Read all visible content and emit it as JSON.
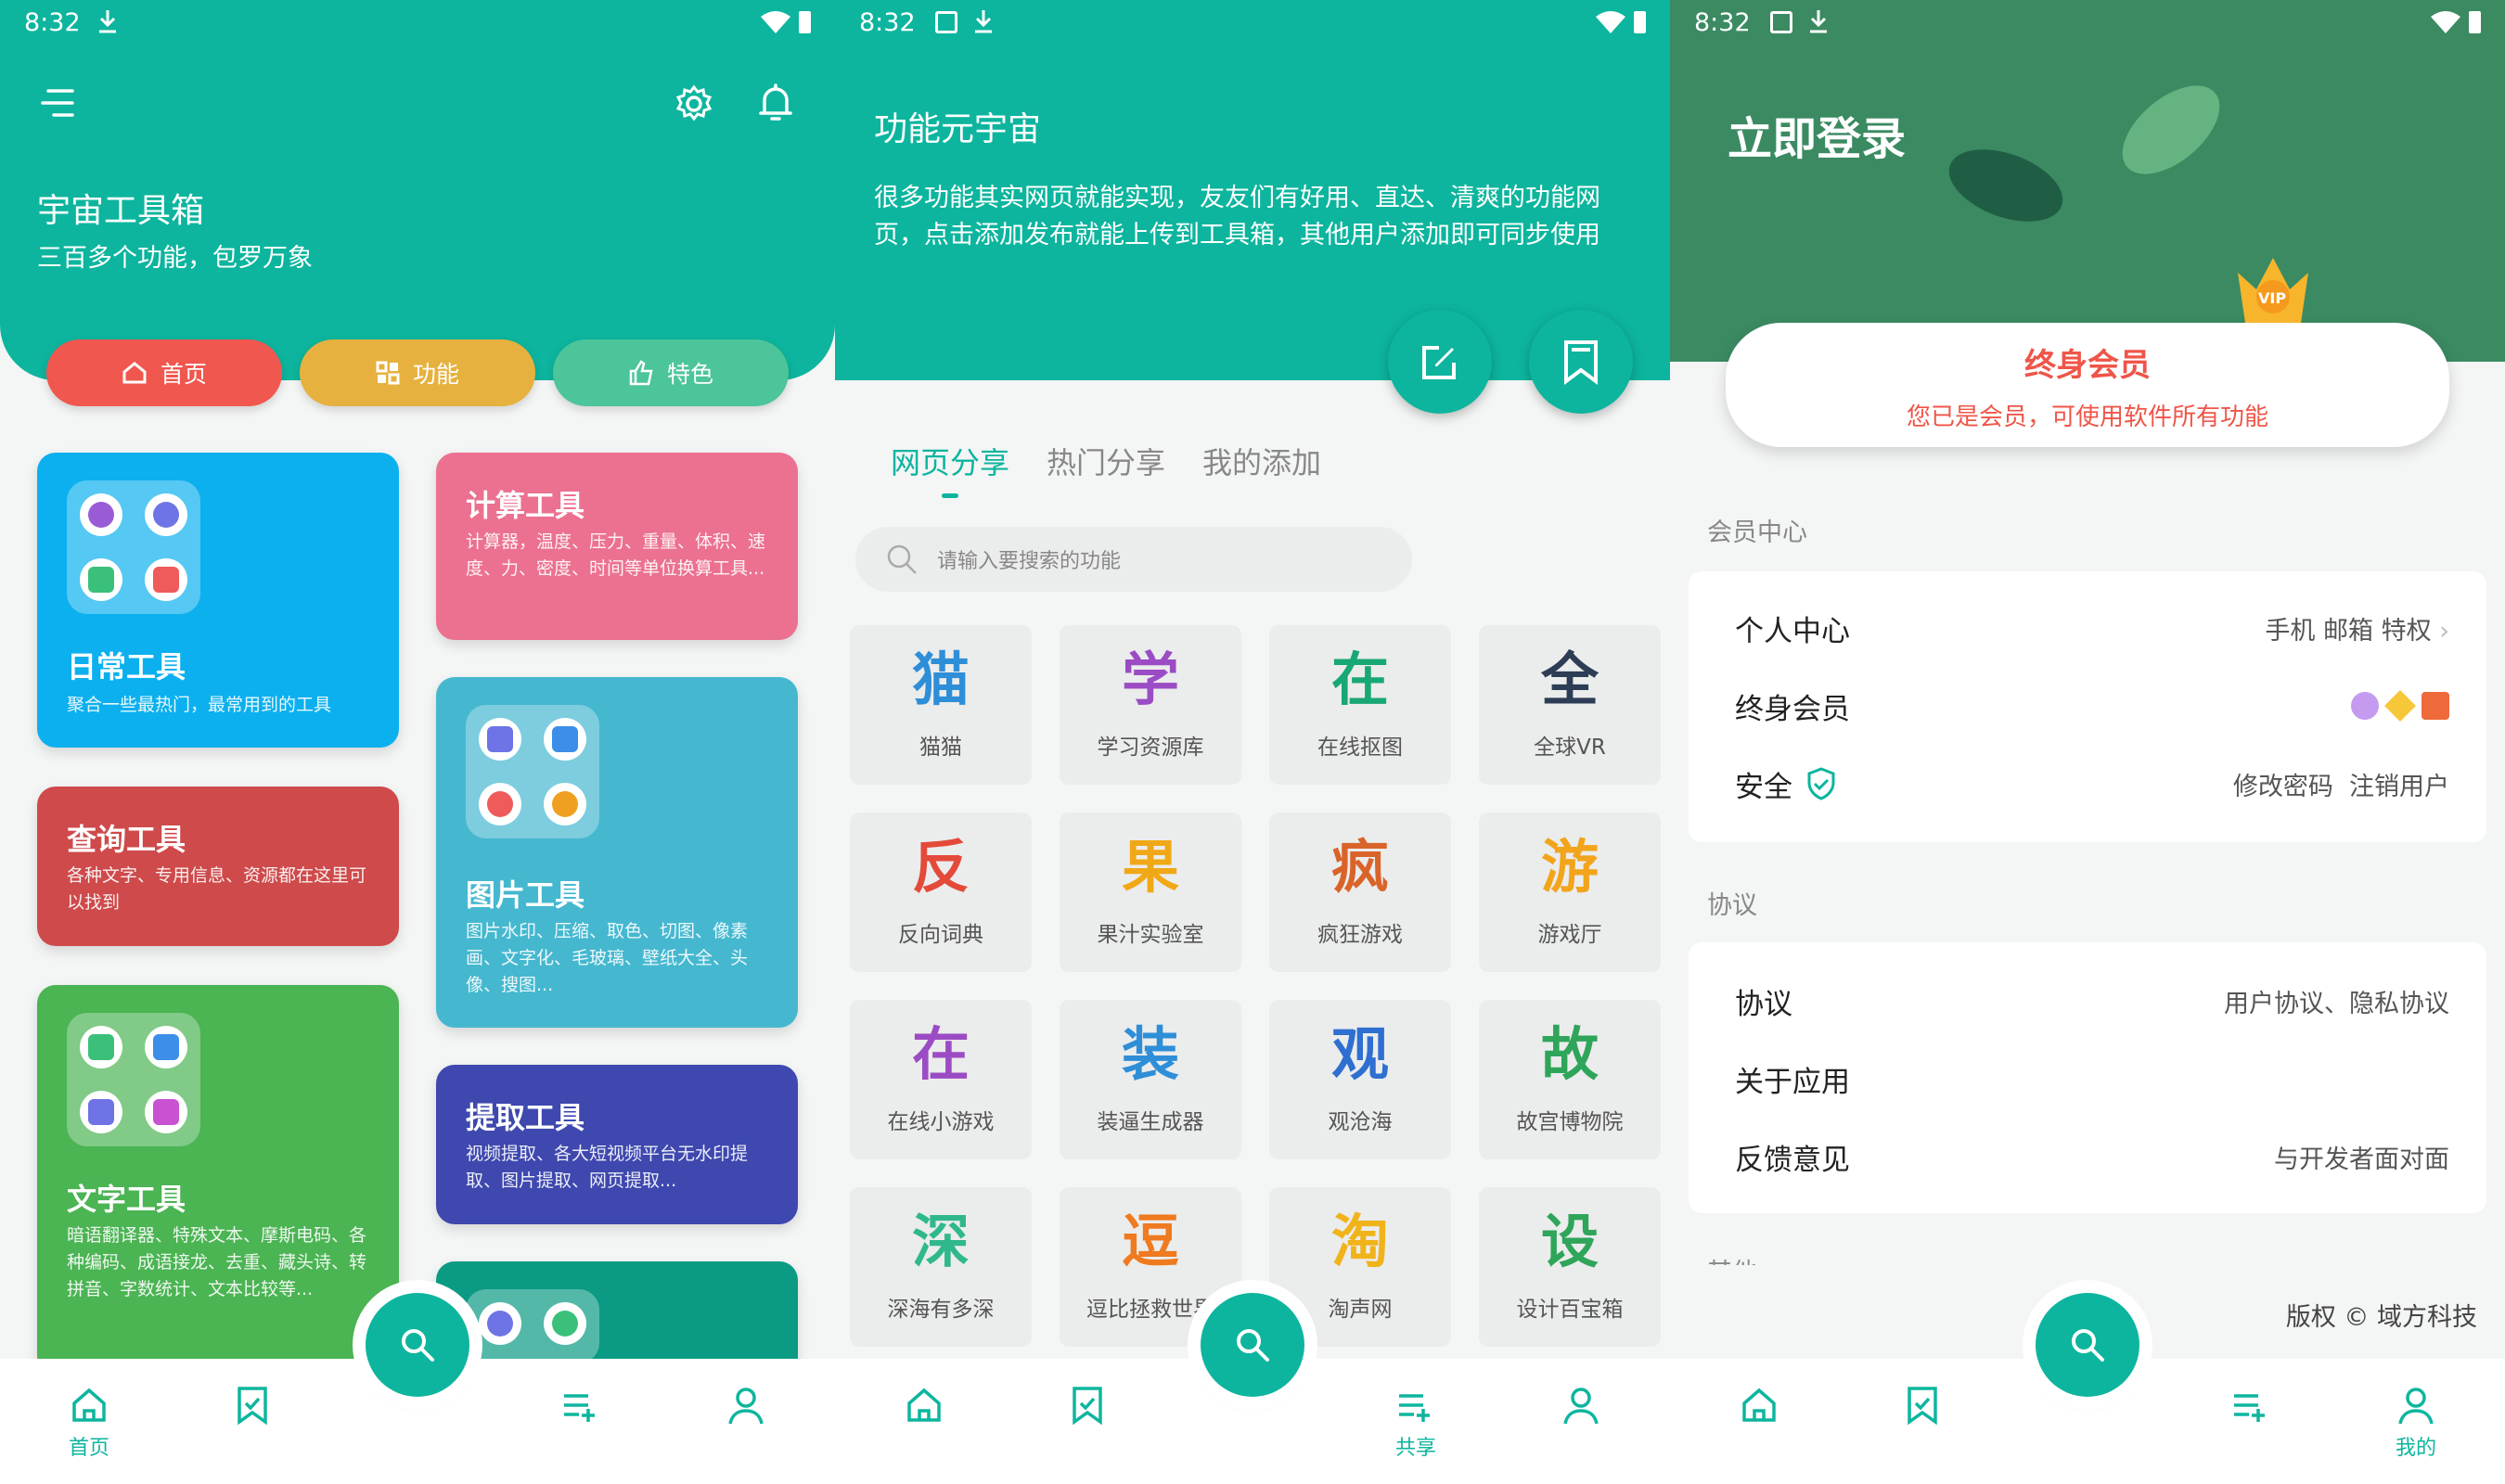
{
  "status": {
    "time": "8:32"
  },
  "screen1": {
    "title": "宇宙工具箱",
    "subtitle": "三百多个功能，包罗万象",
    "pills": [
      {
        "label": "首页",
        "color": "#f0574f"
      },
      {
        "label": "功能",
        "color": "#e6b13e"
      },
      {
        "label": "特色",
        "color": "#4cc59a"
      }
    ],
    "cards": {
      "daily": {
        "title": "日常工具",
        "desc": "聚合一些最热门，最常用到的工具",
        "color": "#0cb0ee"
      },
      "query": {
        "title": "查询工具",
        "desc": "各种文字、专用信息、资源都在这里可以找到",
        "color": "#ce4a4b"
      },
      "text": {
        "title": "文字工具",
        "desc": "暗语翻译器、特殊文本、摩斯电码、各种编码、成语接龙、去重、藏头诗、转拼音、字数统计、文本比较等...",
        "color": "#4bb453"
      },
      "calc": {
        "title": "计算工具",
        "desc": "计算器，温度、压力、重量、体积、速度、力、密度、时间等单位换算工具...",
        "color": "#ec7190"
      },
      "image": {
        "title": "图片工具",
        "desc": "图片水印、压缩、取色、切图、像素画、文字化、毛玻璃、壁纸大全、头像、搜图...",
        "color": "#45b8d0"
      },
      "extract": {
        "title": "提取工具",
        "desc": "视频提取、各大短视频平台无水印提取、图片提取、网页提取...",
        "color": "#3e48ae"
      },
      "more": {
        "color": "#0b9a84"
      }
    }
  },
  "nav": {
    "home": "首页",
    "share": "共享",
    "mine": "我的"
  },
  "screen2": {
    "title": "功能元宇宙",
    "desc": "很多功能其实网页就能实现，友友们有好用、直达、清爽的功能网页，点击添加发布就能上传到工具箱，其他用户添加即可同步使用",
    "tabs": [
      "网页分享",
      "热门分享",
      "我的添加"
    ],
    "search_placeholder": "请输入要搜索的功能",
    "tiles": [
      {
        "g": "猫",
        "l": "猫猫",
        "c": "#2e8ed8"
      },
      {
        "g": "学",
        "l": "学习资源库",
        "c": "#9b4cc4"
      },
      {
        "g": "在",
        "l": "在线抠图",
        "c": "#18a873"
      },
      {
        "g": "全",
        "l": "全球VR",
        "c": "#2d3d55"
      },
      {
        "g": "反",
        "l": "反向词典",
        "c": "#e34a3a"
      },
      {
        "g": "果",
        "l": "果汁实验室",
        "c": "#f0a817"
      },
      {
        "g": "疯",
        "l": "疯狂游戏",
        "c": "#d9642a"
      },
      {
        "g": "游",
        "l": "游戏厅",
        "c": "#f2a41b"
      },
      {
        "g": "在",
        "l": "在线小游戏",
        "c": "#9b4cc4"
      },
      {
        "g": "装",
        "l": "装逼生成器",
        "c": "#2e8ed8"
      },
      {
        "g": "观",
        "l": "观沧海",
        "c": "#2e6fd1"
      },
      {
        "g": "故",
        "l": "故宫博物院",
        "c": "#2fa55a"
      },
      {
        "g": "深",
        "l": "深海有多深",
        "c": "#30b88d"
      },
      {
        "g": "逗",
        "l": "逗比拯救世界",
        "c": "#ef7a1f"
      },
      {
        "g": "淘",
        "l": "淘声网",
        "c": "#f0b31a"
      },
      {
        "g": "设",
        "l": "设计百宝箱",
        "c": "#2fa55a"
      }
    ]
  },
  "screen3": {
    "login": "立即登录",
    "vip_title": "终身会员",
    "vip_sub": "您已是会员，可使用软件所有功能",
    "vip_badge": "VIP",
    "sec_member": "会员中心",
    "sec_agree": "协议",
    "sec_other": "其他",
    "rows1": [
      {
        "l": "个人中心",
        "r": "手机 邮箱 特权"
      },
      {
        "l": "终身会员",
        "r": ""
      },
      {
        "l": "安全",
        "r": "修改密码  注销用户"
      }
    ],
    "rows2": [
      {
        "l": "协议",
        "r": "用户协议、隐私协议"
      },
      {
        "l": "关于应用",
        "r": ""
      },
      {
        "l": "反馈意见",
        "r": "与开发者面对面"
      }
    ],
    "copyright": "版权 © 域方科技"
  }
}
